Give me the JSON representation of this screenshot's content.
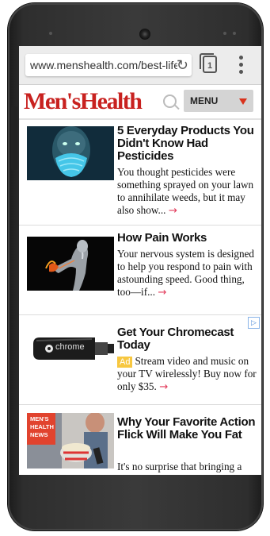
{
  "browser": {
    "url": "www.menshealth.com/best-life/"
  },
  "header": {
    "logo": "Men'sHealth",
    "menu_label": "MENU"
  },
  "articles": [
    {
      "title": "5 Everyday Products You Didn't Know Had Pesticides",
      "desc": "You thought pesticides were something sprayed on your lawn to annihilate weeds, but it may also show...",
      "arrow": "→"
    },
    {
      "title": "How Pain Works",
      "desc": "Your nervous system is designed to help you respond to pain with astounding speed. Good thing, too—if...",
      "arrow": "→"
    },
    {
      "title": "Get Your Chromecast Today",
      "ad_badge": "Ad",
      "desc": "Stream video and music on your TV wirelessly! Buy now for only $35.",
      "arrow": "→",
      "image_label": "chrome"
    },
    {
      "title": "Why Your Favorite Action Flick Will Make You Fat",
      "desc": "It's no surprise that bringing a bottomless tub of popcorn in...",
      "badge": [
        "MEN'S",
        "HEALTH",
        "NEWS"
      ]
    }
  ],
  "colors": {
    "brand": "#c8211f",
    "accent_arrow": "#e23a5a",
    "ad_badge": "#f7c740"
  }
}
